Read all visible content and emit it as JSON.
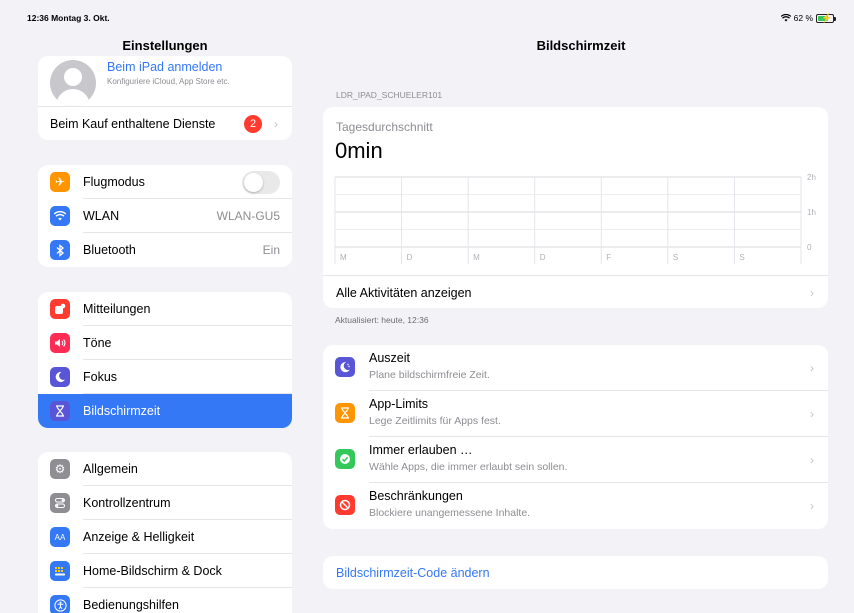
{
  "status_bar": {
    "time_date": "12:36  Montag 3. Okt.",
    "battery": "62 %",
    "battery_level": 0.62
  },
  "sidebar": {
    "title": "Einstellungen",
    "account": {
      "name": "Beim iPad anmelden",
      "subtitle": "Konfiguriere iCloud, App Store etc."
    },
    "purchase_row": {
      "label": "Beim Kauf enthaltene Dienste",
      "badge": "2"
    },
    "group1": [
      {
        "label": "Flugmodus",
        "icon": "airplane-icon",
        "color": "#ff9500",
        "toggle": false
      },
      {
        "label": "WLAN",
        "icon": "wifi-icon",
        "color": "#3478f6",
        "value": "WLAN-GU5"
      },
      {
        "label": "Bluetooth",
        "icon": "bluetooth-icon",
        "color": "#3478f6",
        "value": "Ein"
      }
    ],
    "group2": [
      {
        "label": "Mitteilungen",
        "icon": "notifications-icon",
        "color": "#ff3b30"
      },
      {
        "label": "Töne",
        "icon": "sound-icon",
        "color": "#ff2d55"
      },
      {
        "label": "Fokus",
        "icon": "moon-icon",
        "color": "#5856d6"
      },
      {
        "label": "Bildschirmzeit",
        "icon": "hourglass-icon",
        "color": "#5856d6",
        "selected": true
      }
    ],
    "group3": [
      {
        "label": "Allgemein",
        "icon": "gear-icon",
        "color": "#8e8e93"
      },
      {
        "label": "Kontrollzentrum",
        "icon": "control-center-icon",
        "color": "#8e8e93"
      },
      {
        "label": "Anzeige & Helligkeit",
        "icon": "display-icon",
        "color": "#3478f6"
      },
      {
        "label": "Home-Bildschirm & Dock",
        "icon": "home-screen-icon",
        "color": "#3478f6"
      },
      {
        "label": "Bedienungshilfen",
        "icon": "accessibility-icon",
        "color": "#3478f6"
      }
    ]
  },
  "main": {
    "title": "Bildschirmzeit",
    "device_name": "LDR_IPAD_SCHUELER101",
    "daily_average_label": "Tagesdurchschnitt",
    "daily_average_value": "0min",
    "see_all": "Alle Aktivitäten anzeigen",
    "updated": "Aktualisiert: heute, 12:36",
    "features": [
      {
        "title": "Auszeit",
        "subtitle": "Plane bildschirmfreie Zeit.",
        "icon": "downtime-icon",
        "color": "#5856d6"
      },
      {
        "title": "App-Limits",
        "subtitle": "Lege Zeitlimits für Apps fest.",
        "icon": "hourglass-icon",
        "color": "#ff9500"
      },
      {
        "title": "Immer erlauben …",
        "subtitle": "Wähle Apps, die immer erlaubt sein sollen.",
        "icon": "checkmark-icon",
        "color": "#34c759"
      },
      {
        "title": "Beschränkungen",
        "subtitle": "Blockiere unangemessene Inhalte.",
        "icon": "restriction-icon",
        "color": "#ff3b30"
      }
    ],
    "change_code": "Bildschirmzeit-Code ändern"
  },
  "chart_data": {
    "type": "bar",
    "categories": [
      "M",
      "D",
      "M",
      "D",
      "F",
      "S",
      "S"
    ],
    "values": [
      0,
      0,
      0,
      0,
      0,
      0,
      0
    ],
    "y_ticks": [
      "2h",
      "1h",
      "0"
    ],
    "ylim": [
      0,
      2
    ],
    "grid": true
  }
}
